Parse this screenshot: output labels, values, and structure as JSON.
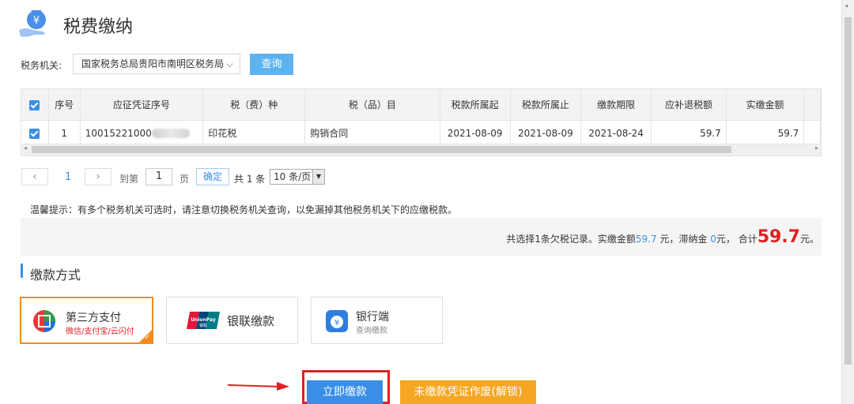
{
  "header": {
    "title": "税费缴纳",
    "icon": "money-bag-hand-icon"
  },
  "authority": {
    "label": "税务机关:",
    "selected": "国家税务总局贵阳市南明区税务局",
    "query_label": "查询"
  },
  "table": {
    "columns": [
      "序号",
      "应征凭证序号",
      "税（费）种",
      "税（品）目",
      "税款所属起",
      "税款所属止",
      "缴款期限",
      "应补退税额",
      "实缴金额"
    ],
    "rows": [
      {
        "index": "1",
        "voucher": "10015221000",
        "tax_type": "印花税",
        "item": "购销合同",
        "period_start": "2021-08-09",
        "period_end": "2021-08-09",
        "deadline": "2021-08-24",
        "due": "59.7",
        "paid": "59.7"
      }
    ]
  },
  "pagination": {
    "current": "1",
    "goto_prefix": "到第",
    "page_value": "1",
    "page_suffix": "页",
    "confirm": "确定",
    "total": "共 1 条",
    "page_size": "10 条/页"
  },
  "tip": "温馨提示：有多个税务机关可选时，请注意切换税务机关查询，以免漏掉其他税务机关下的应缴税款。",
  "summary": {
    "prefix": "共选择1条欠税记录。实缴金额",
    "paid": "59.7",
    "mid1": " 元，滞纳金 ",
    "late": "0",
    "mid2": "元， 合计",
    "total": "59.7",
    "suffix": "元。"
  },
  "payment_method": {
    "title": "缴款方式",
    "options": [
      {
        "title": "第三方支付",
        "subtitle": "微信/支付宝/云闪付",
        "selected": true
      },
      {
        "title": "银联缴款",
        "logo_text": "UnionPay 银联"
      },
      {
        "title": "银行端",
        "subtitle": "查询缴款"
      }
    ]
  },
  "actions": {
    "pay_now": "立即缴款",
    "void_voucher": "未缴款凭证作废(解锁)"
  },
  "colors": {
    "primary": "#3a8ee6",
    "accent_orange": "#f08c1e",
    "highlight_red": "#e02020"
  }
}
